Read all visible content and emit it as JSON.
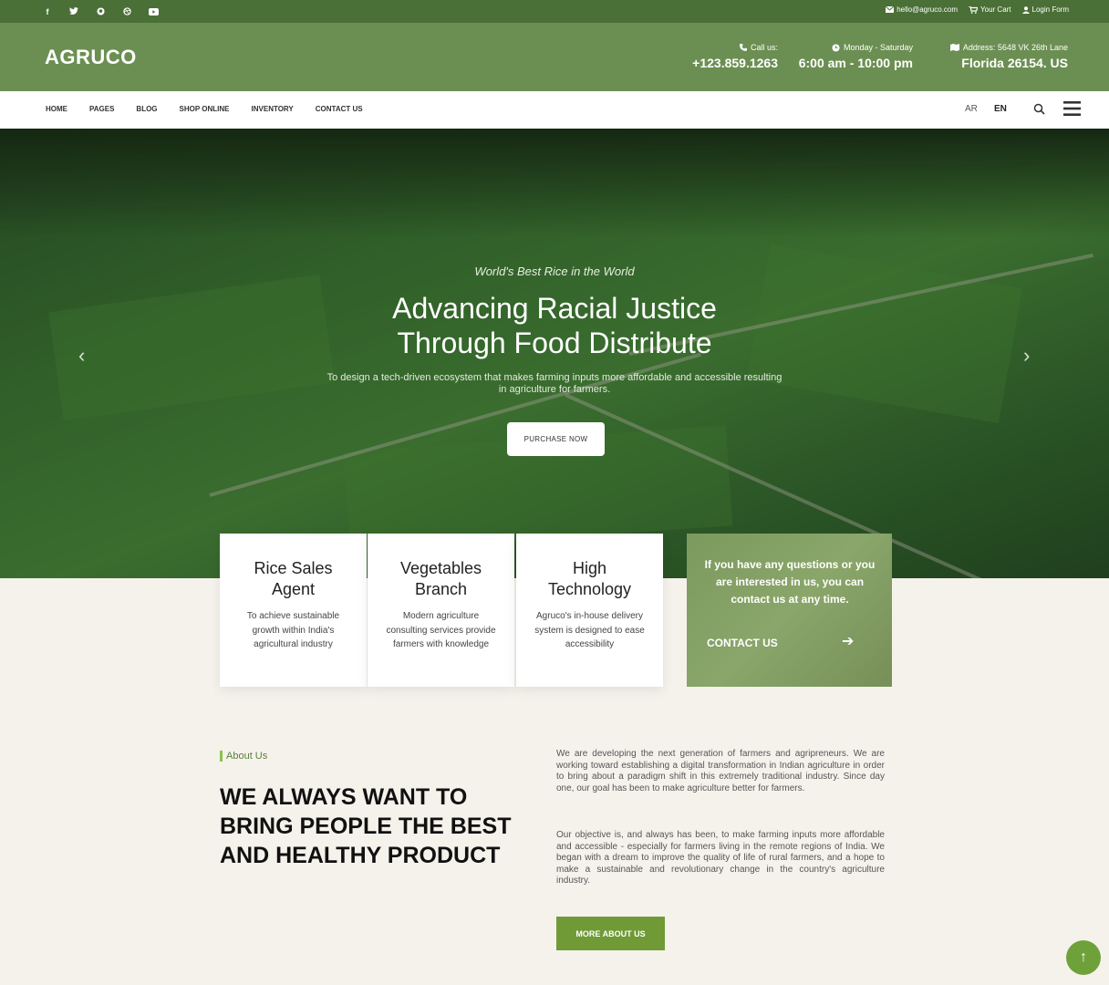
{
  "topbar": {
    "social": [
      "facebook-icon",
      "twitter-icon",
      "github-icon",
      "dribbble-icon",
      "youtube-icon"
    ],
    "email": "hello@agruco.com",
    "cart": "Your Cart",
    "login": "Login Form"
  },
  "header": {
    "logo": "AGRUCO",
    "call_label": "Call us:",
    "call_value": "+123.859.1263",
    "hours_label": "Monday - Saturday",
    "hours_value": "6:00 am - 10:00 pm",
    "address_label": "Address: 5648 VK 26th Lane",
    "address_value": "Florida 26154. US"
  },
  "nav": {
    "items": [
      "HOME",
      "PAGES",
      "BLOG",
      "SHOP ONLINE",
      "INVENTORY",
      "CONTACT US"
    ],
    "lang_ar": "AR",
    "lang_en": "EN"
  },
  "hero": {
    "kicker": "World's Best Rice in the World",
    "title_line1": "Advancing Racial Justice",
    "title_line2": "Through Food Distribute",
    "desc_line1": "To design a tech-driven ecosystem that makes farming inputs more affordable and accessible resulting",
    "desc_line2": "in agriculture for farmers.",
    "button": "PURCHASE NOW"
  },
  "cards": [
    {
      "title": "Rice Sales Agent",
      "desc": "To achieve sustainable growth within India's agricultural industry"
    },
    {
      "title": "Vegetables Branch",
      "desc": "Modern agriculture consulting services provide farmers with knowledge"
    },
    {
      "title": "High Technology",
      "desc": "Agruco's in-house delivery system is designed to ease accessibility"
    }
  ],
  "contact_card": {
    "text": "If you have any questions or you are interested in us, you can contact us at any time.",
    "link": "CONTACT US"
  },
  "about": {
    "kicker": "About Us",
    "title": "WE ALWAYS WANT TO BRING PEOPLE THE BEST AND HEALTHY PRODUCT",
    "p1": "We are developing the next generation of farmers and agripreneurs. We are working toward establishing a digital transformation in Indian agriculture in order to bring about a paradigm shift in this extremely traditional industry. Since day one, our goal has been to make agriculture better for farmers.",
    "p2": "Our objective is, and always has been, to make farming inputs more affordable and accessible - especially for farmers living in the remote regions of India. We began with a dream to improve the quality of life of rural farmers, and a hope to make a sustainable and revolutionary change in the country's agriculture industry.",
    "button": "MORE ABOUT US"
  },
  "colors": {
    "topbar": "#4b7037",
    "header": "#6b8f52",
    "accent": "#6f9a36"
  }
}
